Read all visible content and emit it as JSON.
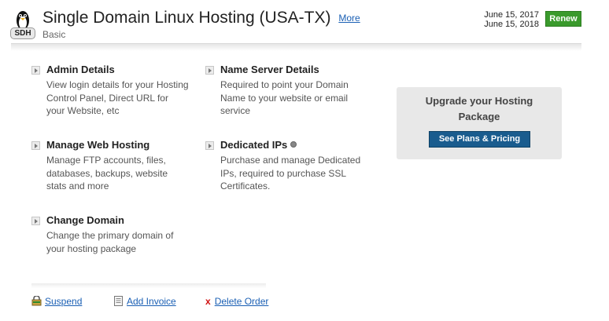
{
  "header": {
    "logo_badge": "SDH",
    "title": "Single Domain Linux Hosting (USA-TX)",
    "more_label": "More",
    "plan": "Basic",
    "date_start": "June 15, 2017",
    "date_end": "June 15, 2018",
    "renew_label": "Renew"
  },
  "items": {
    "admin": {
      "title": "Admin Details",
      "desc": "View login details for your Hosting Control Panel, Direct URL for your Website, etc"
    },
    "nameserver": {
      "title": "Name Server Details",
      "desc": "Required to point your Domain Name to your website or email service"
    },
    "manage": {
      "title": "Manage Web Hosting",
      "desc": "Manage FTP accounts, files, databases, backups, website stats and more"
    },
    "ips": {
      "title": "Dedicated IPs",
      "desc": "Purchase and manage Dedicated IPs, required to purchase SSL Certificates."
    },
    "domain": {
      "title": "Change Domain",
      "desc": "Change the primary domain of your hosting package"
    }
  },
  "upgrade": {
    "title": "Upgrade your Hosting Package",
    "button_label": "See Plans & Pricing"
  },
  "footer": {
    "suspend_label": "Suspend",
    "invoice_label": "Add Invoice",
    "delete_label": "Delete Order"
  },
  "colors": {
    "renew_green": "#3a9a2c",
    "plans_blue": "#1a5c8e",
    "link_blue": "#1a5fb4",
    "delete_red": "#d01010"
  }
}
